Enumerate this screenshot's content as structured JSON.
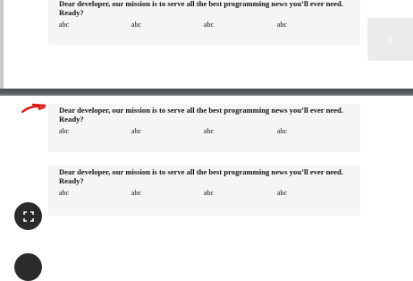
{
  "cards": [
    {
      "message": "Dear developer, our mission is to serve all the best programming news you’ll ever need. Ready?",
      "cells": [
        "abc",
        "abc",
        "abc",
        "abc"
      ]
    },
    {
      "message": "Dear developer, our mission is to serve all the best programming news you’ll ever need. Ready?",
      "cells": [
        "abc",
        "abc",
        "abc",
        "abc"
      ]
    },
    {
      "message": "Dear developer, our mission is to serve all the best programming news you’ll ever need. Ready?",
      "cells": [
        "abc",
        "abc",
        "abc",
        "abc"
      ]
    }
  ],
  "pager": {
    "page_label": "1"
  },
  "icons": {
    "annotation": "red-arrow-annotation",
    "fullscreen": "fullscreen-icon"
  },
  "colors": {
    "card_bg": "#f5f5f5",
    "divider": "#555a5f",
    "annotation_red": "#e01b1b",
    "fab_bg": "#2b2b2b"
  }
}
